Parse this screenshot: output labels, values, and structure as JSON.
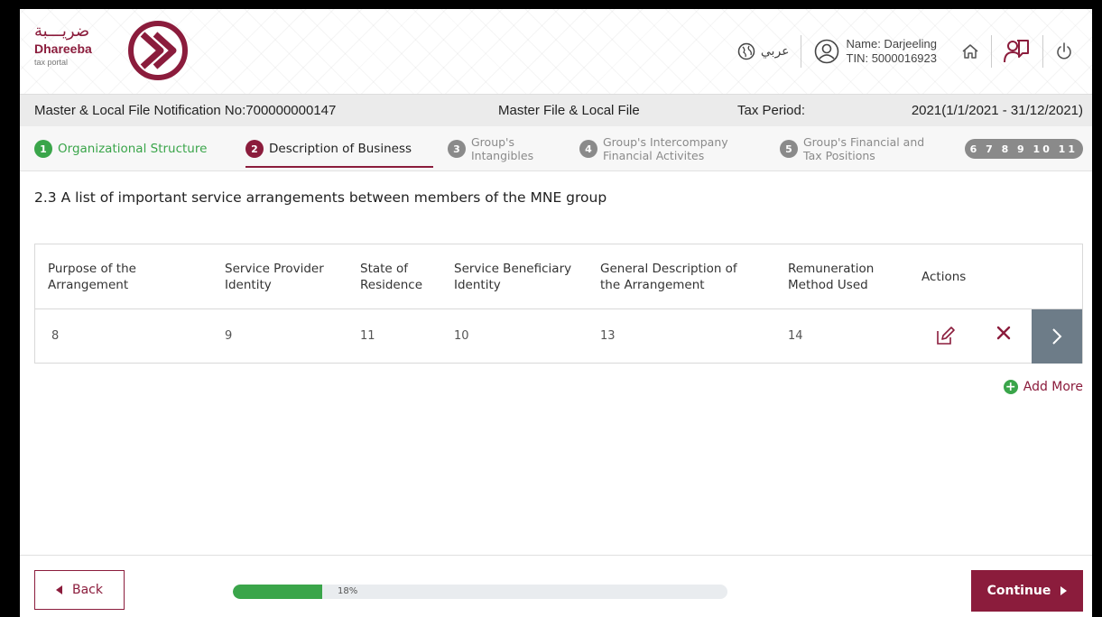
{
  "brand": {
    "arabic_name": "ضريـــبة",
    "name": "Dhareeba",
    "tagline": "tax portal",
    "color": "#8b1c3c"
  },
  "header": {
    "language_label": "عربي",
    "user_name": "Name: Darjeeling",
    "user_tin": "TIN: 5000016923",
    "icons": [
      "globe-icon",
      "user-icon",
      "home-icon",
      "user-manual-icon",
      "power-icon"
    ]
  },
  "notification_bar": {
    "notification_label": "Master & Local File Notification No:700000000147",
    "file_type": "Master File & Local File",
    "tax_period_label": "Tax Period:",
    "tax_period_value": "2021(1/1/2021 - 31/12/2021)"
  },
  "steps": [
    {
      "number": "1",
      "label": "Organizational Structure",
      "status": "done"
    },
    {
      "number": "2",
      "label": "Description of Business",
      "status": "active"
    },
    {
      "number": "3",
      "label": "Group's Intangibles",
      "line1": "Group's",
      "line2": "Intangibles",
      "status": "pending"
    },
    {
      "number": "4",
      "label": "Group's Intercompany Financial Activites",
      "line1": "Group's Intercompany",
      "line2": "Financial Activites",
      "status": "pending"
    },
    {
      "number": "5",
      "label": "Group's Financial and Tax Positions",
      "line1": "Group's Financial and",
      "line2": "Tax Positions",
      "status": "pending"
    }
  ],
  "more_steps": "6 7 8 9 10 11",
  "section_title": "2.3 A list of important service arrangements between members of the MNE group",
  "table": {
    "headers": [
      {
        "line1": "Purpose of the",
        "line2": "Arrangement"
      },
      {
        "line1": "Service Provider",
        "line2": "Identity"
      },
      {
        "line1": "State of",
        "line2": "Residence"
      },
      {
        "line1": "Service Beneficiary",
        "line2": "Identity"
      },
      {
        "line1": "General Description of",
        "line2": "the Arrangement"
      },
      {
        "line1": "Remuneration",
        "line2": "Method Used"
      },
      {
        "line1": "Actions",
        "line2": ""
      }
    ],
    "rows": [
      {
        "purpose": "8",
        "provider": "9",
        "state": "11",
        "beneficiary": "10",
        "description": "13",
        "remuneration": "14"
      }
    ]
  },
  "add_more_label": "Add More",
  "footer": {
    "back_label": "Back",
    "progress_percent": 18,
    "progress_label": "18%",
    "continue_label": "Continue",
    "progress_color": "#3aa54a"
  }
}
